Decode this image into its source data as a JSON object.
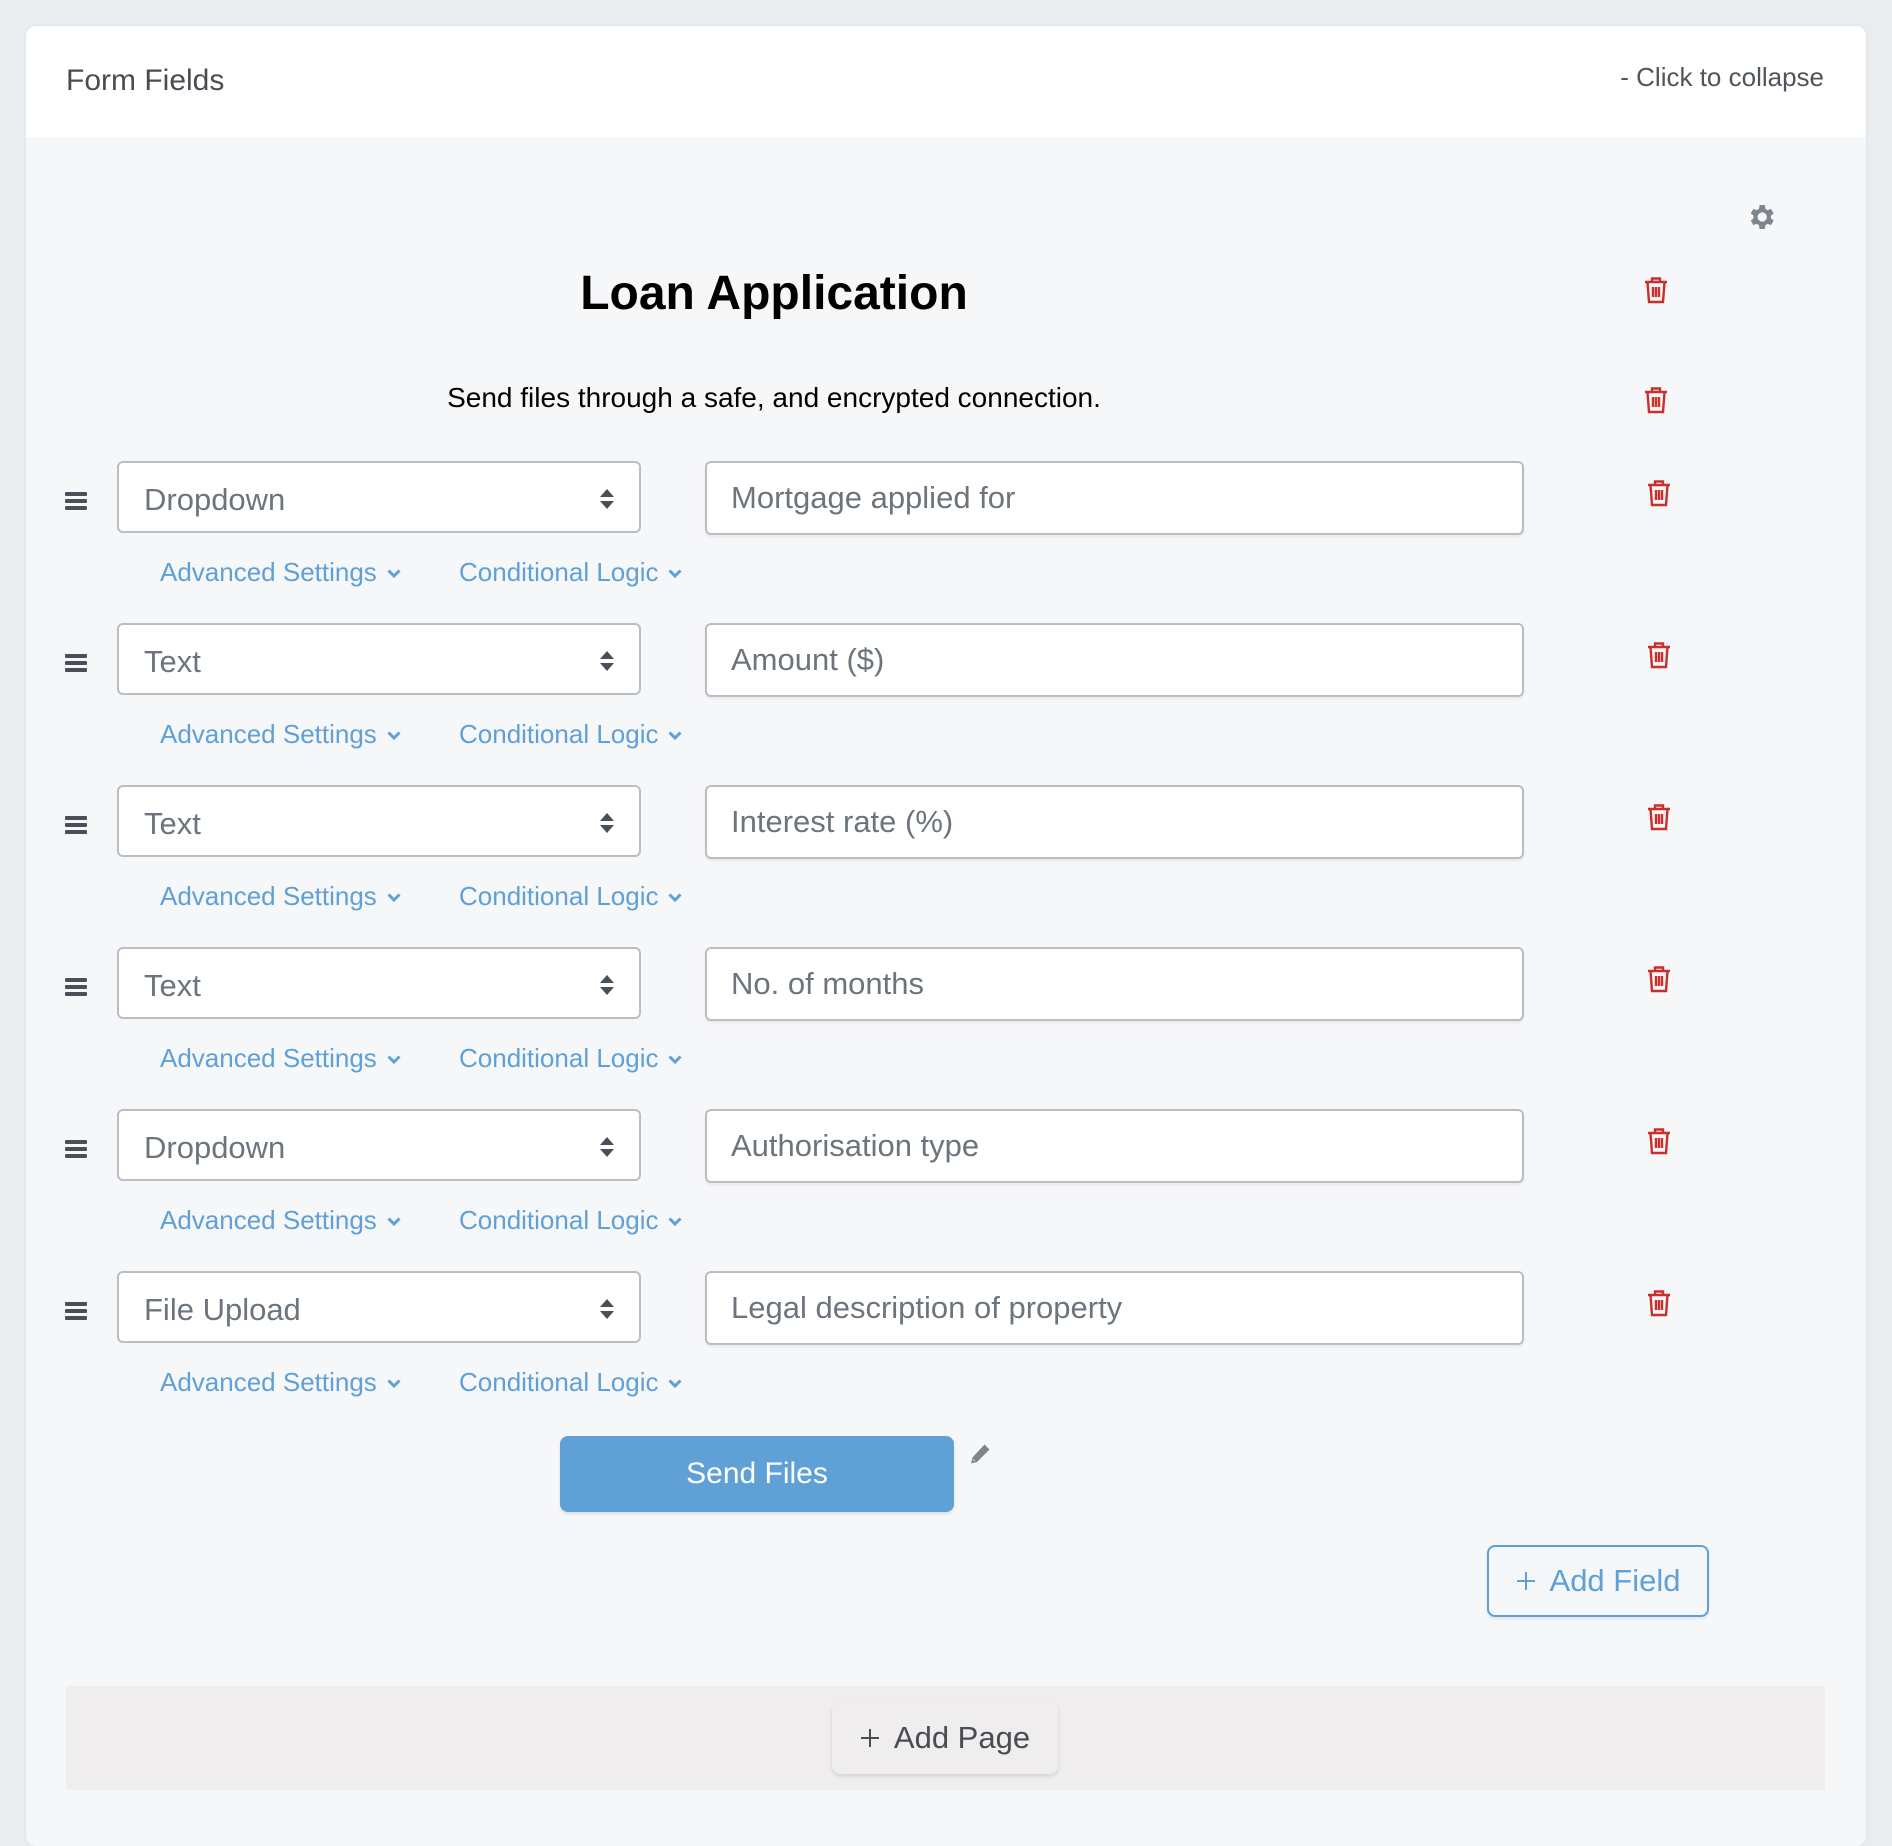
{
  "panel": {
    "title": "Form Fields",
    "collapse_label": "- Click to collapse"
  },
  "form": {
    "title": "Loan Application",
    "subtitle": "Send files through a safe, and encrypted connection."
  },
  "fields": [
    {
      "type": "Dropdown",
      "label": "Mortgage applied for"
    },
    {
      "type": "Text",
      "label": "Amount ($)"
    },
    {
      "type": "Text",
      "label": "Interest rate (%)"
    },
    {
      "type": "Text",
      "label": "No. of months"
    },
    {
      "type": "Dropdown",
      "label": "Authorisation type"
    },
    {
      "type": "File Upload",
      "label": "Legal description of property"
    }
  ],
  "field_links": {
    "advanced": "Advanced Settings",
    "conditional": "Conditional Logic"
  },
  "submit": {
    "label": "Send Files"
  },
  "actions": {
    "add_field": "Add Field",
    "add_page": "Add Page"
  },
  "icons": {
    "settings": "gear-icon",
    "delete": "trash-icon",
    "drag": "drag-handle-icon",
    "select_arrows": "sort-arrows-icon",
    "chevron": "chevron-down-icon",
    "edit": "pencil-icon",
    "add": "plus-icon"
  },
  "colors": {
    "accent": "#5fa0d6",
    "danger": "#c9302c",
    "muted_text": "#6c757d",
    "icon_gray": "#7d858d"
  }
}
